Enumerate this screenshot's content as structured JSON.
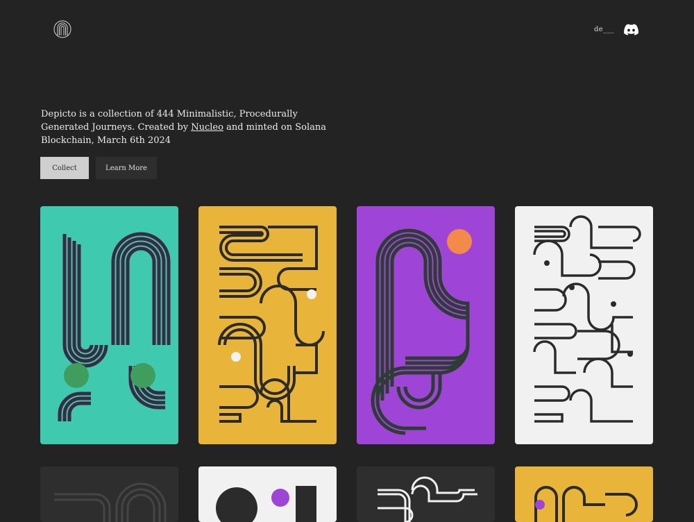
{
  "header": {
    "logo_icon": "depicto-logo-icon",
    "language_label": "de___",
    "discord_icon": "discord-icon"
  },
  "intro": {
    "text_before_link": "Depicto is a collection of 444 Minimalistic, Procedurally Generated Journeys. Created by ",
    "link_text": "Nucleo",
    "text_after_link": " and minted on Solana Blockchain, March 6th 2024"
  },
  "actions": {
    "collect_label": "Collect",
    "learn_more_label": "Learn More"
  },
  "gallery": {
    "card_colors": [
      "#3fcab0",
      "#e8b53a",
      "#9e45d8",
      "#f1f1f1",
      "#2e2e2e",
      "#f1f1f1",
      "#2e2e2e",
      "#e8b53a"
    ]
  },
  "colors": {
    "background": "#232323",
    "collect_button": "#cfcfcf",
    "learn_more_button": "#2e2e2e"
  }
}
